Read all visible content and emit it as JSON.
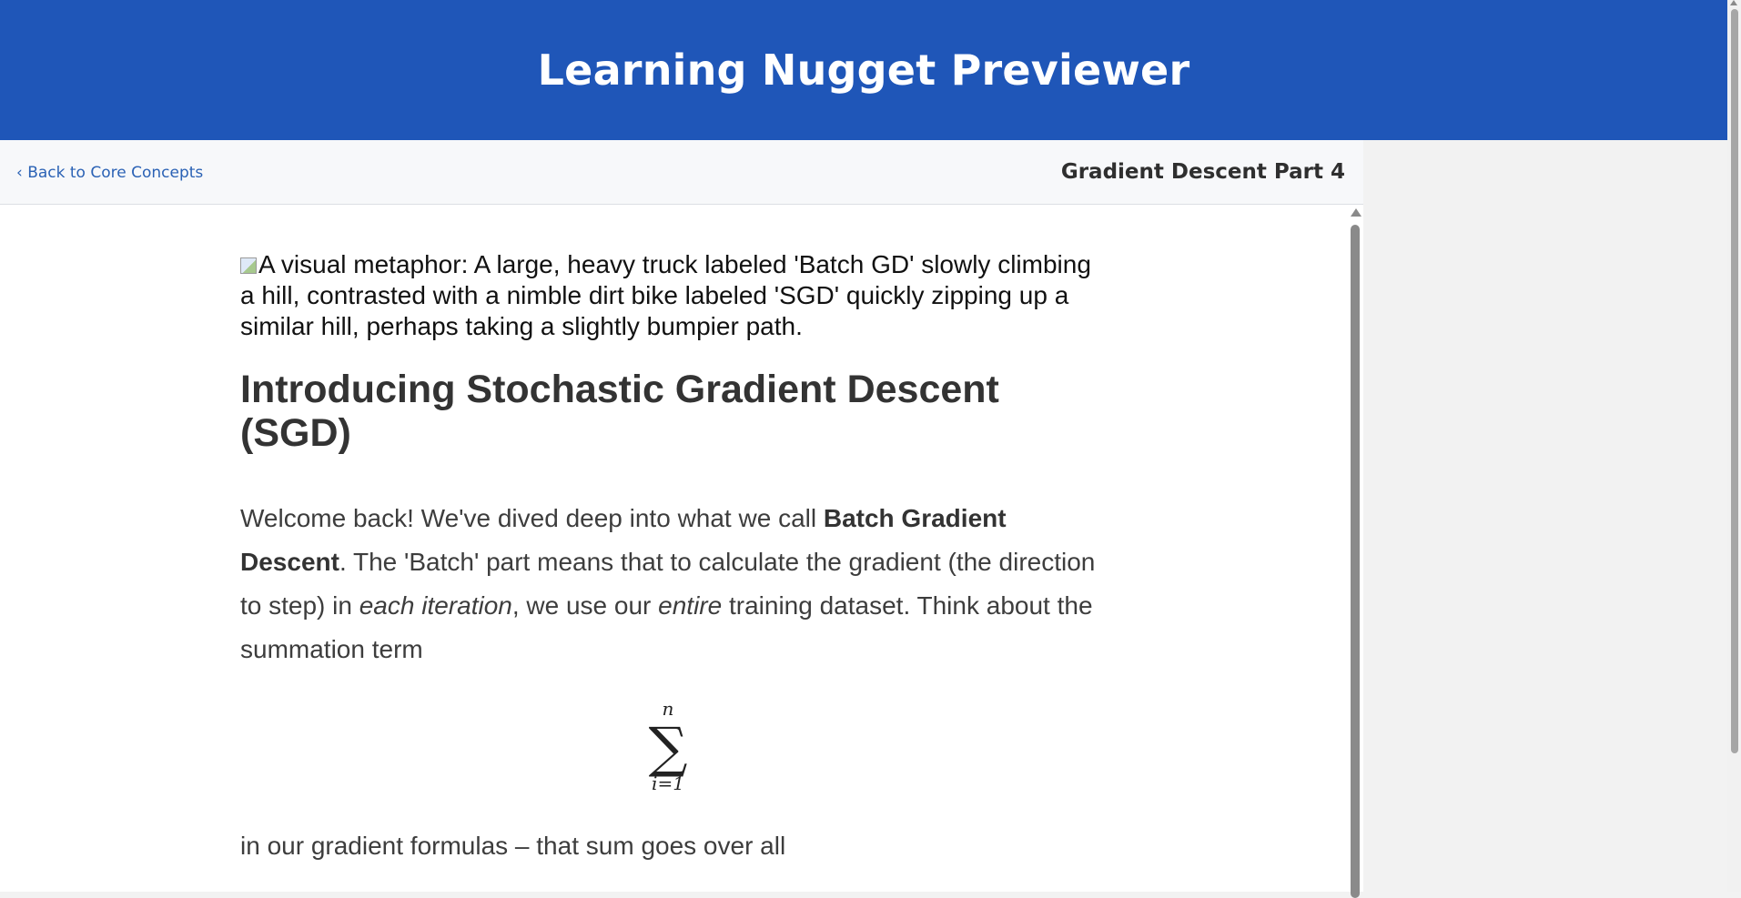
{
  "app": {
    "title": "Learning Nugget Previewer"
  },
  "nav": {
    "back_label": "‹ Back to Core Concepts",
    "nugget_title": "Gradient Descent Part 4"
  },
  "content": {
    "image_alt": "A visual metaphor: A large, heavy truck labeled 'Batch GD' slowly climbing a hill, contrasted with a nimble dirt bike labeled 'SGD' quickly zipping up a similar hill, perhaps taking a slightly bumpier path.",
    "heading": "Introducing Stochastic Gradient Descent (SGD)",
    "para1": {
      "t1": "Welcome back! We've dived deep into what we call ",
      "b1": "Batch Gradient Descent",
      "t2": ". The 'Batch' part means that to calculate the gradient (the direction to step) in ",
      "i1": "each iteration",
      "t3": ", we use our ",
      "i2": "entire",
      "t4": " training dataset. Think about the summation term"
    },
    "formula": {
      "upper": "n",
      "symbol": "∑",
      "lower": "i=1"
    },
    "para2": "in our gradient formulas – that sum goes over all"
  }
}
